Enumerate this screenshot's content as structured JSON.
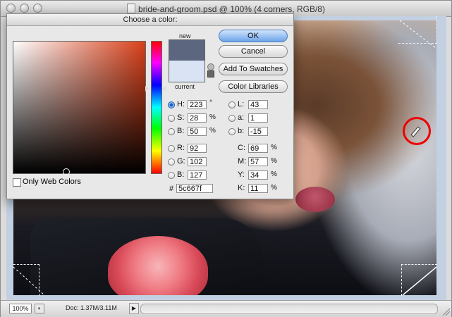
{
  "window": {
    "title": "bride-and-groom.psd @ 100% (4 corners, RGB/8)"
  },
  "status": {
    "zoom": "100%",
    "doc_info": "Doc: 1.37M/3.11M"
  },
  "dialog": {
    "title": "Choose a color:",
    "new_label": "new",
    "current_label": "current",
    "colors": {
      "new": "#5c667f",
      "current": "#d9e3f4"
    },
    "buttons": {
      "ok": "OK",
      "cancel": "Cancel",
      "add_to_swatches": "Add To Swatches",
      "color_libraries": "Color Libraries"
    },
    "only_web_colors": "Only Web Colors",
    "hsb": {
      "h": {
        "label": "H:",
        "value": "223",
        "unit": "°"
      },
      "s": {
        "label": "S:",
        "value": "28",
        "unit": "%"
      },
      "b": {
        "label": "B:",
        "value": "50",
        "unit": "%"
      }
    },
    "rgb": {
      "r": {
        "label": "R:",
        "value": "92"
      },
      "g": {
        "label": "G:",
        "value": "102"
      },
      "b": {
        "label": "B:",
        "value": "127"
      }
    },
    "hex": {
      "label": "#",
      "value": "5c667f"
    },
    "lab": {
      "l": {
        "label": "L:",
        "value": "43"
      },
      "a": {
        "label": "a:",
        "value": "1"
      },
      "b": {
        "label": "b:",
        "value": "-15"
      }
    },
    "cmyk": {
      "c": {
        "label": "C:",
        "value": "69",
        "unit": "%"
      },
      "m": {
        "label": "M:",
        "value": "57",
        "unit": "%"
      },
      "y": {
        "label": "Y:",
        "value": "34",
        "unit": "%"
      },
      "k": {
        "label": "K:",
        "value": "11",
        "unit": "%"
      }
    }
  }
}
